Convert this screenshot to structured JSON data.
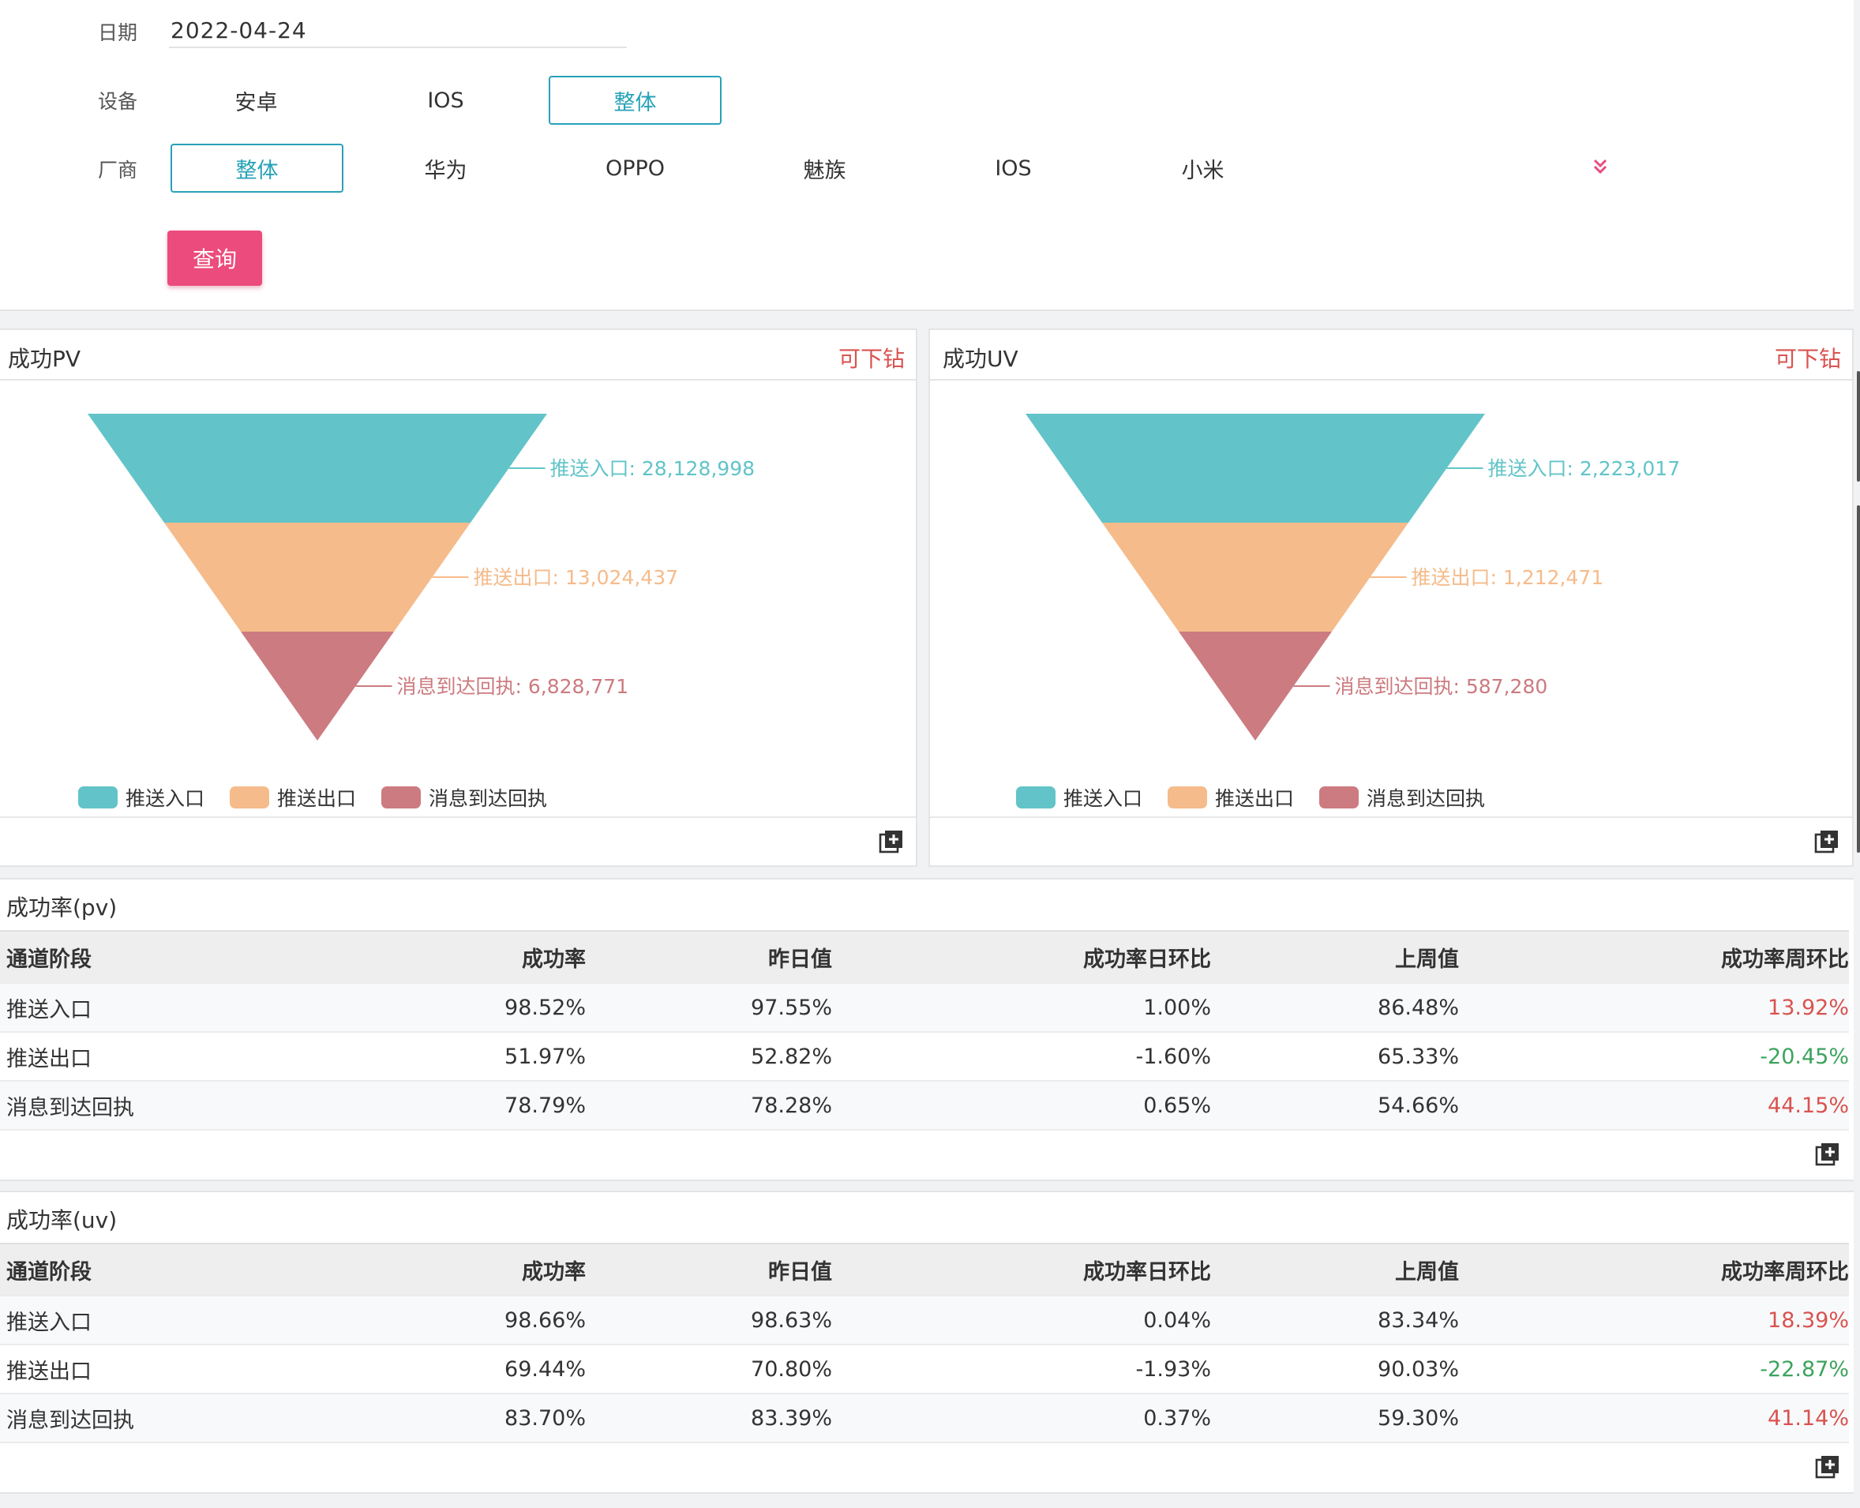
{
  "filters": {
    "date_label": "日期",
    "date_value": "2022-04-24",
    "device_label": "设备",
    "device_options": [
      "安卓",
      "IOS",
      "整体"
    ],
    "vendor_label": "厂商",
    "vendor_options": [
      "整体",
      "华为",
      "OPPO",
      "魅族",
      "IOS",
      "小米"
    ],
    "query_button": "查询"
  },
  "charts": [
    {
      "title": "成功PV",
      "drill": "可下钻",
      "chart_data": {
        "type": "funnel",
        "stages": [
          {
            "name": "推送入口",
            "value": 28128998,
            "label": "推送入口: 28,128,998",
            "color": "#62c4c8"
          },
          {
            "name": "推送出口",
            "value": 13024437,
            "label": "推送出口: 13,024,437",
            "color": "#f5bb8b"
          },
          {
            "name": "消息到达回执",
            "value": 6828771,
            "label": "消息到达回执: 6,828,771",
            "color": "#cc7b80"
          }
        ],
        "legend": [
          "推送入口",
          "推送出口",
          "消息到达回执"
        ]
      }
    },
    {
      "title": "成功UV",
      "drill": "可下钻",
      "chart_data": {
        "type": "funnel",
        "stages": [
          {
            "name": "推送入口",
            "value": 2223017,
            "label": "推送入口: 2,223,017",
            "color": "#62c4c8"
          },
          {
            "name": "推送出口",
            "value": 1212471,
            "label": "推送出口: 1,212,471",
            "color": "#f5bb8b"
          },
          {
            "name": "消息到达回执",
            "value": 587280,
            "label": "消息到达回执: 587,280",
            "color": "#cc7b80"
          }
        ],
        "legend": [
          "推送入口",
          "推送出口",
          "消息到达回执"
        ]
      }
    }
  ],
  "tables": [
    {
      "title": "成功率(pv)",
      "headers": [
        "通道阶段",
        "成功率",
        "昨日值",
        "成功率日环比",
        "上周值",
        "成功率周环比"
      ],
      "rows": [
        [
          "推送入口",
          "98.52%",
          "97.55%",
          "1.00%",
          "86.48%",
          "13.92%"
        ],
        [
          "推送出口",
          "51.97%",
          "52.82%",
          "-1.60%",
          "65.33%",
          "-20.45%"
        ],
        [
          "消息到达回执",
          "78.79%",
          "78.28%",
          "0.65%",
          "54.66%",
          "44.15%"
        ]
      ]
    },
    {
      "title": "成功率(uv)",
      "headers": [
        "通道阶段",
        "成功率",
        "昨日值",
        "成功率日环比",
        "上周值",
        "成功率周环比"
      ],
      "rows": [
        [
          "推送入口",
          "98.66%",
          "98.63%",
          "0.04%",
          "83.34%",
          "18.39%"
        ],
        [
          "推送出口",
          "69.44%",
          "70.80%",
          "-1.93%",
          "90.03%",
          "-22.87%"
        ],
        [
          "消息到达回执",
          "83.70%",
          "83.39%",
          "0.37%",
          "59.30%",
          "41.14%"
        ]
      ]
    }
  ],
  "colors": {
    "accent": "#27a2b8",
    "query": "#ec4b7d",
    "positive": "#d9534f",
    "negative": "#3da35d"
  }
}
